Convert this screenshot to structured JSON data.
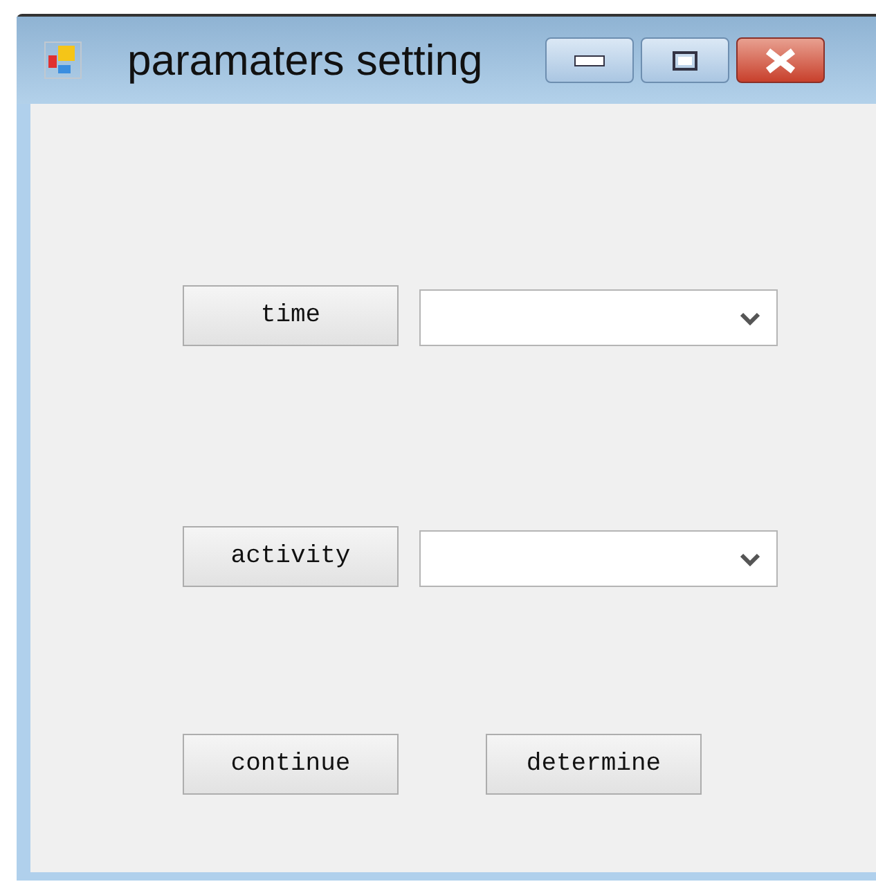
{
  "window": {
    "title": "paramaters setting"
  },
  "fields": [
    {
      "label": "time"
    },
    {
      "label": "activity"
    }
  ],
  "buttons": [
    "continue",
    "determine"
  ]
}
